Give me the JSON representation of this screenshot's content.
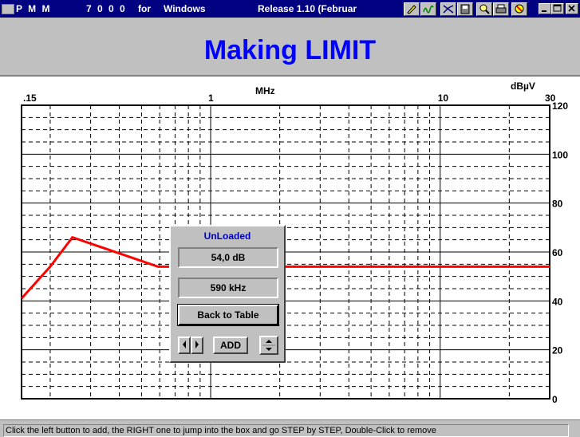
{
  "window": {
    "title_parts": [
      "P M M",
      "7 0 0 0",
      "for",
      "Windows"
    ],
    "release": "Release 1.10 (Februar"
  },
  "toolbar": {
    "icons": [
      "pencil-icon",
      "wave-icon",
      "signal-icon",
      "disk-icon",
      "zoom-icon",
      "print-icon",
      "clear-icon"
    ]
  },
  "header": {
    "title": "Making LIMIT"
  },
  "plot": {
    "x_unit": "MHz",
    "y_unit": "dBµV",
    "x_ticks": [
      ".15",
      "1",
      "10",
      "30"
    ],
    "y_ticks": [
      "120",
      "100",
      "80",
      "60",
      "40",
      "20",
      "0"
    ]
  },
  "limit_line": {
    "type": "line",
    "x_scale": "log",
    "x_range": [
      0.15,
      30
    ],
    "y_range": [
      0,
      120
    ],
    "color": "#ff0000",
    "points": [
      [
        0.15,
        41
      ],
      [
        0.2,
        54
      ],
      [
        0.25,
        66
      ],
      [
        0.59,
        54
      ],
      [
        30,
        54
      ]
    ]
  },
  "panel": {
    "title": "UnLoaded",
    "level": "54,0 dB",
    "frequency": "590 kHz",
    "back_label": "Back to Table",
    "add_label": "ADD"
  },
  "status": {
    "text": "Click the left button to add, the RIGHT one to jump into the box and go STEP by STEP, Double-Click to remove"
  },
  "colors": {
    "title_blue": "#0000ff",
    "titlebar": "#000080",
    "limit_red": "#ff0000"
  }
}
